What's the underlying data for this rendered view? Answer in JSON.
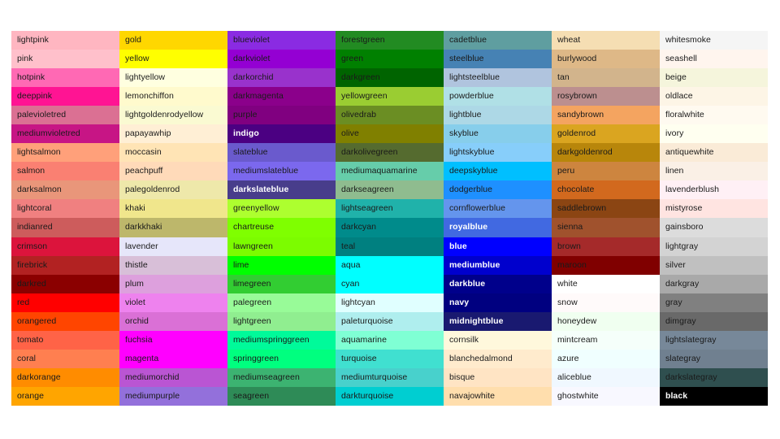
{
  "chart_data": {
    "type": "table",
    "title": "",
    "description": "Named color reference chart: 7 columns by 20 rows of color swatches labeled with CSS/matplotlib color names",
    "columns": 7,
    "rows": 20,
    "background": "#ffffff",
    "default_label_color": "#1a1a1a",
    "light_label_color": "#ffffff",
    "cells": [
      [
        {
          "name": "lightpink",
          "hex": "#ffb6c1",
          "label_color": "dark"
        },
        {
          "name": "gold",
          "hex": "#ffd700",
          "label_color": "dark"
        },
        {
          "name": "blueviolet",
          "hex": "#8a2be2",
          "label_color": "dark"
        },
        {
          "name": "forestgreen",
          "hex": "#228b22",
          "label_color": "dark"
        },
        {
          "name": "cadetblue",
          "hex": "#5f9ea0",
          "label_color": "dark"
        },
        {
          "name": "wheat",
          "hex": "#f5deb3",
          "label_color": "dark"
        },
        {
          "name": "whitesmoke",
          "hex": "#f5f5f5",
          "label_color": "dark"
        }
      ],
      [
        {
          "name": "pink",
          "hex": "#ffc0cb",
          "label_color": "dark"
        },
        {
          "name": "yellow",
          "hex": "#ffff00",
          "label_color": "dark"
        },
        {
          "name": "darkviolet",
          "hex": "#9400d3",
          "label_color": "dark"
        },
        {
          "name": "green",
          "hex": "#008000",
          "label_color": "dark"
        },
        {
          "name": "steelblue",
          "hex": "#4682b4",
          "label_color": "dark"
        },
        {
          "name": "burlywood",
          "hex": "#deb887",
          "label_color": "dark"
        },
        {
          "name": "seashell",
          "hex": "#fff5ee",
          "label_color": "dark"
        }
      ],
      [
        {
          "name": "hotpink",
          "hex": "#ff69b4",
          "label_color": "dark"
        },
        {
          "name": "lightyellow",
          "hex": "#ffffe0",
          "label_color": "dark"
        },
        {
          "name": "darkorchid",
          "hex": "#9932cc",
          "label_color": "dark"
        },
        {
          "name": "darkgreen",
          "hex": "#006400",
          "label_color": "dark"
        },
        {
          "name": "lightsteelblue",
          "hex": "#b0c4de",
          "label_color": "dark"
        },
        {
          "name": "tan",
          "hex": "#d2b48c",
          "label_color": "dark"
        },
        {
          "name": "beige",
          "hex": "#f5f5dc",
          "label_color": "dark"
        }
      ],
      [
        {
          "name": "deeppink",
          "hex": "#ff1493",
          "label_color": "dark"
        },
        {
          "name": "lemonchiffon",
          "hex": "#fffacd",
          "label_color": "dark"
        },
        {
          "name": "darkmagenta",
          "hex": "#8b008b",
          "label_color": "dark"
        },
        {
          "name": "yellowgreen",
          "hex": "#9acd32",
          "label_color": "dark"
        },
        {
          "name": "powderblue",
          "hex": "#b0e0e6",
          "label_color": "dark"
        },
        {
          "name": "rosybrown",
          "hex": "#bc8f8f",
          "label_color": "dark"
        },
        {
          "name": "oldlace",
          "hex": "#fdf5e6",
          "label_color": "dark"
        }
      ],
      [
        {
          "name": "palevioletred",
          "hex": "#db7093",
          "label_color": "dark"
        },
        {
          "name": "lightgoldenrodyellow",
          "hex": "#fafad2",
          "label_color": "dark"
        },
        {
          "name": "purple",
          "hex": "#800080",
          "label_color": "dark"
        },
        {
          "name": "olivedrab",
          "hex": "#6b8e23",
          "label_color": "dark"
        },
        {
          "name": "lightblue",
          "hex": "#add8e6",
          "label_color": "dark"
        },
        {
          "name": "sandybrown",
          "hex": "#f4a460",
          "label_color": "dark"
        },
        {
          "name": "floralwhite",
          "hex": "#fffaf0",
          "label_color": "dark"
        }
      ],
      [
        {
          "name": "mediumvioletred",
          "hex": "#c71585",
          "label_color": "dark"
        },
        {
          "name": "papayawhip",
          "hex": "#ffefd5",
          "label_color": "dark"
        },
        {
          "name": "indigo",
          "hex": "#4b0082",
          "label_color": "light"
        },
        {
          "name": "olive",
          "hex": "#808000",
          "label_color": "dark"
        },
        {
          "name": "skyblue",
          "hex": "#87ceeb",
          "label_color": "dark"
        },
        {
          "name": "goldenrod",
          "hex": "#daa520",
          "label_color": "dark"
        },
        {
          "name": "ivory",
          "hex": "#fffff0",
          "label_color": "dark"
        }
      ],
      [
        {
          "name": "lightsalmon",
          "hex": "#ffa07a",
          "label_color": "dark"
        },
        {
          "name": "moccasin",
          "hex": "#ffe4b5",
          "label_color": "dark"
        },
        {
          "name": "slateblue",
          "hex": "#6a5acd",
          "label_color": "dark"
        },
        {
          "name": "darkolivegreen",
          "hex": "#556b2f",
          "label_color": "dark"
        },
        {
          "name": "lightskyblue",
          "hex": "#87cefa",
          "label_color": "dark"
        },
        {
          "name": "darkgoldenrod",
          "hex": "#b8860b",
          "label_color": "dark"
        },
        {
          "name": "antiquewhite",
          "hex": "#faebd7",
          "label_color": "dark"
        }
      ],
      [
        {
          "name": "salmon",
          "hex": "#fa8072",
          "label_color": "dark"
        },
        {
          "name": "peachpuff",
          "hex": "#ffdab9",
          "label_color": "dark"
        },
        {
          "name": "mediumslateblue",
          "hex": "#7b68ee",
          "label_color": "dark"
        },
        {
          "name": "mediumaquamarine",
          "hex": "#66cdaa",
          "label_color": "dark"
        },
        {
          "name": "deepskyblue",
          "hex": "#00bfff",
          "label_color": "dark"
        },
        {
          "name": "peru",
          "hex": "#cd853f",
          "label_color": "dark"
        },
        {
          "name": "linen",
          "hex": "#faf0e6",
          "label_color": "dark"
        }
      ],
      [
        {
          "name": "darksalmon",
          "hex": "#e9967a",
          "label_color": "dark"
        },
        {
          "name": "palegoldenrod",
          "hex": "#eee8aa",
          "label_color": "dark"
        },
        {
          "name": "darkslateblue",
          "hex": "#483d8b",
          "label_color": "light"
        },
        {
          "name": "darkseagreen",
          "hex": "#8fbc8f",
          "label_color": "dark"
        },
        {
          "name": "dodgerblue",
          "hex": "#1e90ff",
          "label_color": "dark"
        },
        {
          "name": "chocolate",
          "hex": "#d2691e",
          "label_color": "dark"
        },
        {
          "name": "lavenderblush",
          "hex": "#fff0f5",
          "label_color": "dark"
        }
      ],
      [
        {
          "name": "lightcoral",
          "hex": "#f08080",
          "label_color": "dark"
        },
        {
          "name": "khaki",
          "hex": "#f0e68c",
          "label_color": "dark"
        },
        {
          "name": "greenyellow",
          "hex": "#adff2f",
          "label_color": "dark"
        },
        {
          "name": "lightseagreen",
          "hex": "#20b2aa",
          "label_color": "dark"
        },
        {
          "name": "cornflowerblue",
          "hex": "#6495ed",
          "label_color": "dark"
        },
        {
          "name": "saddlebrown",
          "hex": "#8b4513",
          "label_color": "dark"
        },
        {
          "name": "mistyrose",
          "hex": "#ffe4e1",
          "label_color": "dark"
        }
      ],
      [
        {
          "name": "indianred",
          "hex": "#cd5c5c",
          "label_color": "dark"
        },
        {
          "name": "darkkhaki",
          "hex": "#bdb76b",
          "label_color": "dark"
        },
        {
          "name": "chartreuse",
          "hex": "#7fff00",
          "label_color": "dark"
        },
        {
          "name": "darkcyan",
          "hex": "#008b8b",
          "label_color": "dark"
        },
        {
          "name": "royalblue",
          "hex": "#4169e1",
          "label_color": "light"
        },
        {
          "name": "sienna",
          "hex": "#a0522d",
          "label_color": "dark"
        },
        {
          "name": "gainsboro",
          "hex": "#dcdcdc",
          "label_color": "dark"
        }
      ],
      [
        {
          "name": "crimson",
          "hex": "#dc143c",
          "label_color": "dark"
        },
        {
          "name": "lavender",
          "hex": "#e6e6fa",
          "label_color": "dark"
        },
        {
          "name": "lawngreen",
          "hex": "#7cfc00",
          "label_color": "dark"
        },
        {
          "name": "teal",
          "hex": "#008080",
          "label_color": "dark"
        },
        {
          "name": "blue",
          "hex": "#0000ff",
          "label_color": "light"
        },
        {
          "name": "brown",
          "hex": "#a52a2a",
          "label_color": "dark"
        },
        {
          "name": "lightgray",
          "hex": "#d3d3d3",
          "label_color": "dark"
        }
      ],
      [
        {
          "name": "firebrick",
          "hex": "#b22222",
          "label_color": "dark"
        },
        {
          "name": "thistle",
          "hex": "#d8bfd8",
          "label_color": "dark"
        },
        {
          "name": "lime",
          "hex": "#00ff00",
          "label_color": "dark"
        },
        {
          "name": "aqua",
          "hex": "#00ffff",
          "label_color": "dark"
        },
        {
          "name": "mediumblue",
          "hex": "#0000cd",
          "label_color": "light"
        },
        {
          "name": "maroon",
          "hex": "#800000",
          "label_color": "dark"
        },
        {
          "name": "silver",
          "hex": "#c0c0c0",
          "label_color": "dark"
        }
      ],
      [
        {
          "name": "darkred",
          "hex": "#8b0000",
          "label_color": "dark"
        },
        {
          "name": "plum",
          "hex": "#dda0dd",
          "label_color": "dark"
        },
        {
          "name": "limegreen",
          "hex": "#32cd32",
          "label_color": "dark"
        },
        {
          "name": "cyan",
          "hex": "#00ffff",
          "label_color": "dark"
        },
        {
          "name": "darkblue",
          "hex": "#00008b",
          "label_color": "light"
        },
        {
          "name": "white",
          "hex": "#ffffff",
          "label_color": "dark"
        },
        {
          "name": "darkgray",
          "hex": "#a9a9a9",
          "label_color": "dark"
        }
      ],
      [
        {
          "name": "red",
          "hex": "#ff0000",
          "label_color": "dark"
        },
        {
          "name": "violet",
          "hex": "#ee82ee",
          "label_color": "dark"
        },
        {
          "name": "palegreen",
          "hex": "#98fb98",
          "label_color": "dark"
        },
        {
          "name": "lightcyan",
          "hex": "#e0ffff",
          "label_color": "dark"
        },
        {
          "name": "navy",
          "hex": "#000080",
          "label_color": "light"
        },
        {
          "name": "snow",
          "hex": "#fffafa",
          "label_color": "dark"
        },
        {
          "name": "gray",
          "hex": "#808080",
          "label_color": "dark"
        }
      ],
      [
        {
          "name": "orangered",
          "hex": "#ff4500",
          "label_color": "dark"
        },
        {
          "name": "orchid",
          "hex": "#da70d6",
          "label_color": "dark"
        },
        {
          "name": "lightgreen",
          "hex": "#90ee90",
          "label_color": "dark"
        },
        {
          "name": "paleturquoise",
          "hex": "#afeeee",
          "label_color": "dark"
        },
        {
          "name": "midnightblue",
          "hex": "#191970",
          "label_color": "light"
        },
        {
          "name": "honeydew",
          "hex": "#f0fff0",
          "label_color": "dark"
        },
        {
          "name": "dimgray",
          "hex": "#696969",
          "label_color": "dark"
        }
      ],
      [
        {
          "name": "tomato",
          "hex": "#ff6347",
          "label_color": "dark"
        },
        {
          "name": "fuchsia",
          "hex": "#ff00ff",
          "label_color": "dark"
        },
        {
          "name": "mediumspringgreen",
          "hex": "#00fa9a",
          "label_color": "dark"
        },
        {
          "name": "aquamarine",
          "hex": "#7fffd4",
          "label_color": "dark"
        },
        {
          "name": "cornsilk",
          "hex": "#fff8dc",
          "label_color": "dark"
        },
        {
          "name": "mintcream",
          "hex": "#f5fffa",
          "label_color": "dark"
        },
        {
          "name": "lightslategray",
          "hex": "#778899",
          "label_color": "dark"
        }
      ],
      [
        {
          "name": "coral",
          "hex": "#ff7f50",
          "label_color": "dark"
        },
        {
          "name": "magenta",
          "hex": "#ff00ff",
          "label_color": "dark"
        },
        {
          "name": "springgreen",
          "hex": "#00ff7f",
          "label_color": "dark"
        },
        {
          "name": "turquoise",
          "hex": "#40e0d0",
          "label_color": "dark"
        },
        {
          "name": "blanchedalmond",
          "hex": "#ffebcd",
          "label_color": "dark"
        },
        {
          "name": "azure",
          "hex": "#f0ffff",
          "label_color": "dark"
        },
        {
          "name": "slategray",
          "hex": "#708090",
          "label_color": "dark"
        }
      ],
      [
        {
          "name": "darkorange",
          "hex": "#ff8c00",
          "label_color": "dark"
        },
        {
          "name": "mediumorchid",
          "hex": "#ba55d3",
          "label_color": "dark"
        },
        {
          "name": "mediumseagreen",
          "hex": "#3cb371",
          "label_color": "dark"
        },
        {
          "name": "mediumturquoise",
          "hex": "#48d1cc",
          "label_color": "dark"
        },
        {
          "name": "bisque",
          "hex": "#ffe4c4",
          "label_color": "dark"
        },
        {
          "name": "aliceblue",
          "hex": "#f0f8ff",
          "label_color": "dark"
        },
        {
          "name": "darkslategray",
          "hex": "#2f4f4f",
          "label_color": "dark"
        }
      ],
      [
        {
          "name": "orange",
          "hex": "#ffa500",
          "label_color": "dark"
        },
        {
          "name": "mediumpurple",
          "hex": "#9370db",
          "label_color": "dark"
        },
        {
          "name": "seagreen",
          "hex": "#2e8b57",
          "label_color": "dark"
        },
        {
          "name": "darkturquoise",
          "hex": "#00ced1",
          "label_color": "dark"
        },
        {
          "name": "navajowhite",
          "hex": "#ffdead",
          "label_color": "dark"
        },
        {
          "name": "ghostwhite",
          "hex": "#f8f8ff",
          "label_color": "dark"
        },
        {
          "name": "black",
          "hex": "#000000",
          "label_color": "light"
        }
      ]
    ]
  }
}
